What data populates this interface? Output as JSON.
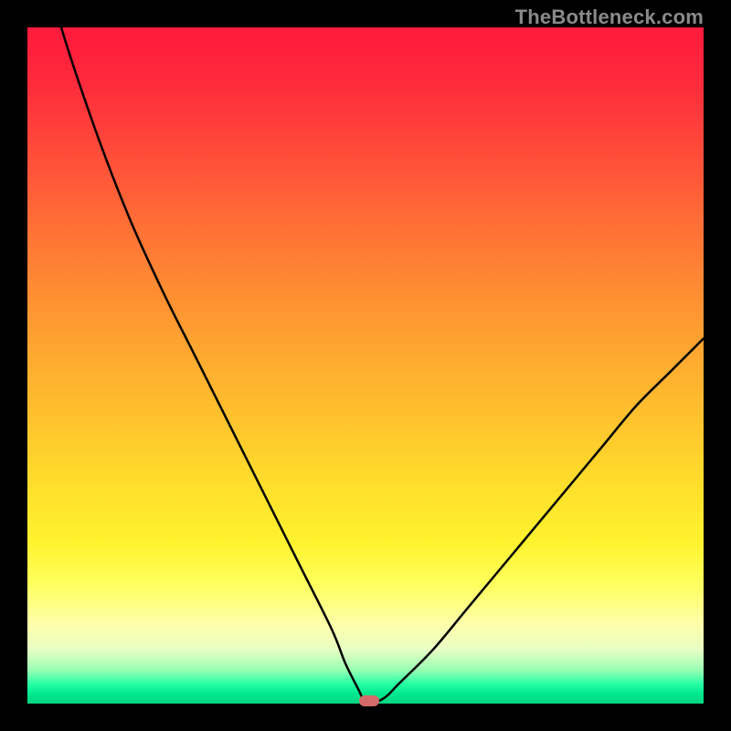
{
  "watermark": "TheBottleneck.com",
  "colors": {
    "frame": "#000000",
    "curve": "#000000",
    "marker": "#d46a6a",
    "gradient_top": "#ff1a3c",
    "gradient_bottom": "#00d482"
  },
  "chart_data": {
    "type": "line",
    "title": "",
    "xlabel": "",
    "ylabel": "",
    "xlim": [
      0,
      100
    ],
    "ylim": [
      0,
      100
    ],
    "series": [
      {
        "name": "bottleneck-curve",
        "x": [
          0,
          5,
          10,
          15,
          20,
          25,
          30,
          35,
          40,
          45,
          47,
          49,
          50,
          51,
          53,
          55,
          60,
          65,
          70,
          75,
          80,
          85,
          90,
          95,
          100
        ],
        "values": [
          118,
          100,
          85,
          72,
          61,
          51,
          41,
          31,
          21,
          11,
          6,
          2,
          0,
          0,
          1,
          3,
          8,
          14,
          20,
          26,
          32,
          38,
          44,
          49,
          54
        ]
      }
    ],
    "marker": {
      "x": 50.5,
      "y": 0
    },
    "notes": "V-shaped bottleneck curve; minimum at approximately x=50 on a rainbow vertical gradient background. Axes are unlabeled in the source image."
  }
}
